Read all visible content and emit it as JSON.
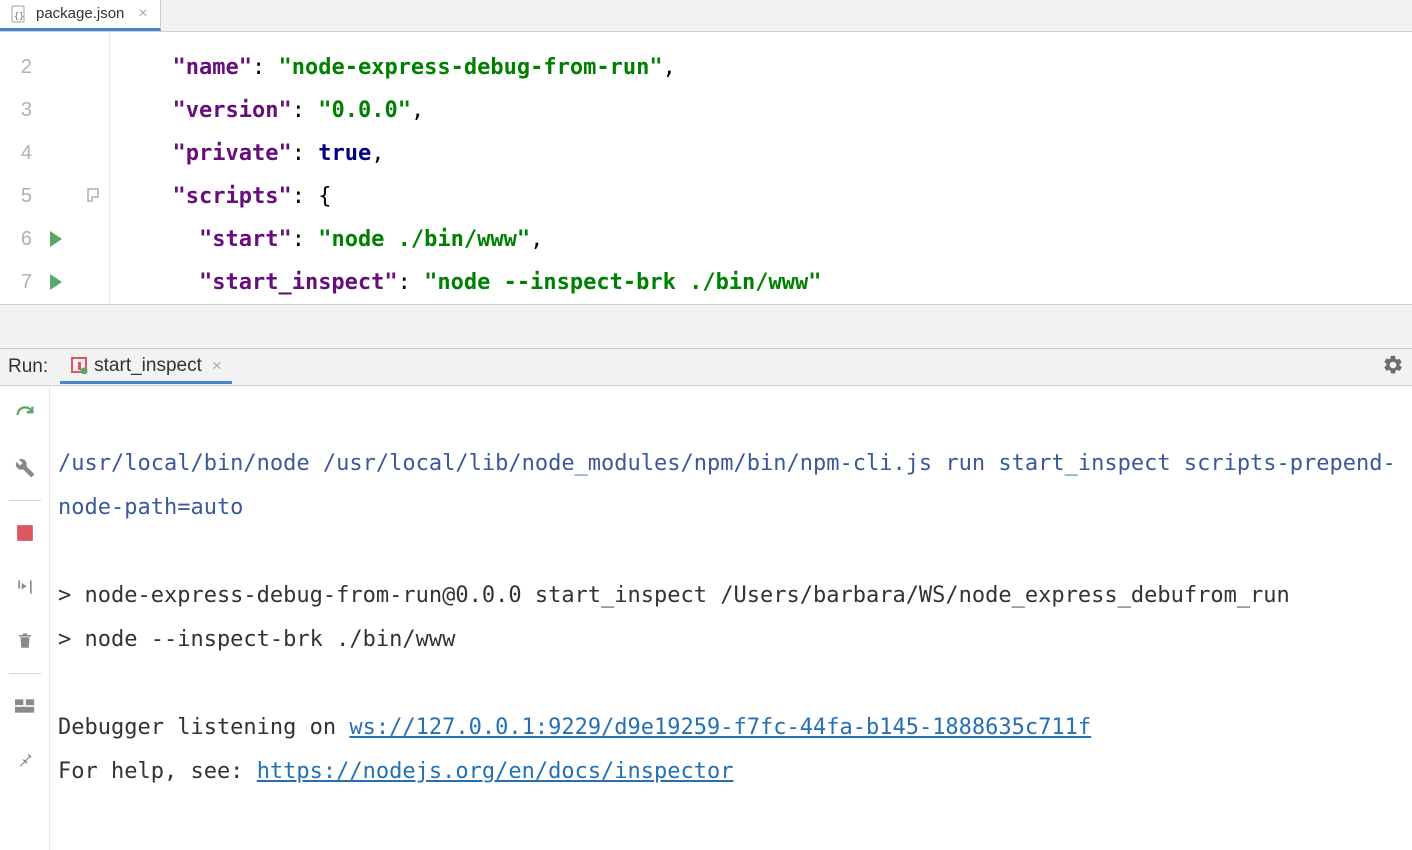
{
  "editor": {
    "tab": {
      "filename": "package.json"
    },
    "lines": [
      {
        "num": "2",
        "indent": 1,
        "key": "\"name\"",
        "sep": ": ",
        "val": "\"node-express-debug-from-run\"",
        "valType": "str",
        "trail": ","
      },
      {
        "num": "3",
        "indent": 1,
        "key": "\"version\"",
        "sep": ": ",
        "val": "\"0.0.0\"",
        "valType": "str",
        "trail": ","
      },
      {
        "num": "4",
        "indent": 1,
        "key": "\"private\"",
        "sep": ": ",
        "val": "true",
        "valType": "bool",
        "trail": ","
      },
      {
        "num": "5",
        "indent": 1,
        "key": "\"scripts\"",
        "sep": ": ",
        "val": "{",
        "valType": "punc",
        "trail": "",
        "fold": true
      },
      {
        "num": "6",
        "indent": 2,
        "key": "\"start\"",
        "sep": ": ",
        "val": "\"node ./bin/www\"",
        "valType": "str",
        "trail": ",",
        "run": true
      },
      {
        "num": "7",
        "indent": 2,
        "key": "\"start_inspect\"",
        "sep": ": ",
        "val": "\"node --inspect-brk ./bin/www\"",
        "valType": "str",
        "trail": "",
        "run": true
      }
    ]
  },
  "runpanel": {
    "label": "Run:",
    "tab": "start_inspect",
    "console": {
      "cmd": "/usr/local/bin/node /usr/local/lib/node_modules/npm/bin/npm-cli.js run start_inspect scripts-prepend-node-path=auto",
      "out1": "> node-express-debug-from-run@0.0.0 start_inspect /Users/barbara/WS/node_express_debufrom_run",
      "out2": "> node --inspect-brk ./bin/www",
      "dbg_pre": "Debugger listening on ",
      "dbg_link": "ws://127.0.0.1:9229/d9e19259-f7fc-44fa-b145-1888635c711f",
      "help_pre": "For help, see: ",
      "help_link": "https://nodejs.org/en/docs/inspector"
    }
  }
}
